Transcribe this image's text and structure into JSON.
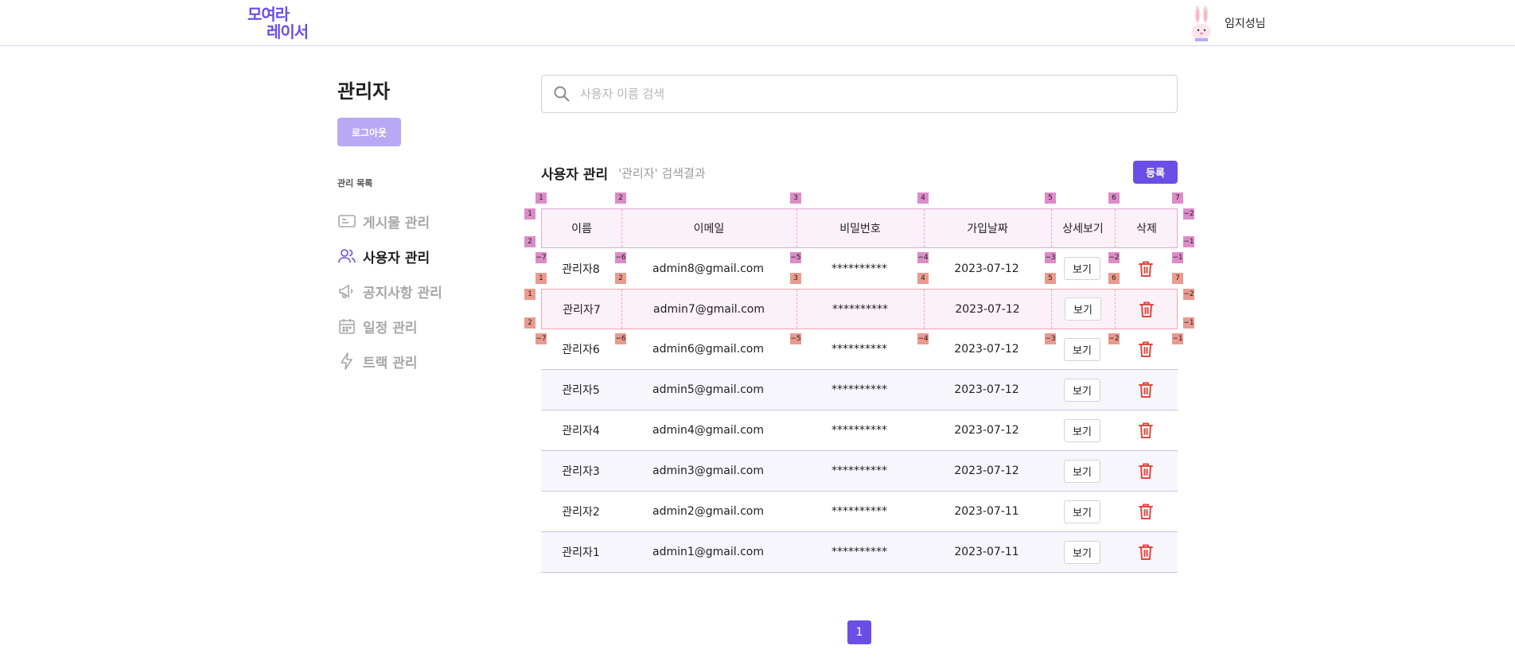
{
  "header": {
    "logo_line1": "모여라",
    "logo_line2": "레이서",
    "user_name": "임지성님"
  },
  "sidebar": {
    "title": "관리자",
    "logout_label": "로그아웃",
    "menu_title": "관리 목록",
    "items": [
      {
        "label": "게시물 관리",
        "icon": "card-icon",
        "active": false
      },
      {
        "label": "사용자 관리",
        "icon": "users-icon",
        "active": true
      },
      {
        "label": "공지사항 관리",
        "icon": "megaphone-icon",
        "active": false
      },
      {
        "label": "일정 관리",
        "icon": "calendar-icon",
        "active": false
      },
      {
        "label": "트랙 관리",
        "icon": "lightning-icon",
        "active": false
      }
    ]
  },
  "search": {
    "placeholder": "사용자 이름 검색"
  },
  "section": {
    "title": "사용자 관리",
    "subtitle": "'관리자' 검색결과",
    "register_label": "등록"
  },
  "table": {
    "headers": [
      "이름",
      "이메일",
      "비밀번호",
      "가입날짜",
      "상세보기",
      "삭제"
    ],
    "view_label": "보기",
    "rows": [
      {
        "name": "관리자8",
        "email": "admin8@gmail.com",
        "password": "**********",
        "date": "2023-07-12"
      },
      {
        "name": "관리자7",
        "email": "admin7@gmail.com",
        "password": "**********",
        "date": "2023-07-12"
      },
      {
        "name": "관리자6",
        "email": "admin6@gmail.com",
        "password": "**********",
        "date": "2023-07-12"
      },
      {
        "name": "관리자5",
        "email": "admin5@gmail.com",
        "password": "**********",
        "date": "2023-07-12"
      },
      {
        "name": "관리자4",
        "email": "admin4@gmail.com",
        "password": "**********",
        "date": "2023-07-12"
      },
      {
        "name": "관리자3",
        "email": "admin3@gmail.com",
        "password": "**********",
        "date": "2023-07-12"
      },
      {
        "name": "관리자2",
        "email": "admin2@gmail.com",
        "password": "**********",
        "date": "2023-07-11"
      },
      {
        "name": "관리자1",
        "email": "admin1@gmail.com",
        "password": "**********",
        "date": "2023-07-11"
      }
    ]
  },
  "pagination": {
    "current": "1"
  },
  "colors": {
    "accent": "#6b4ee6",
    "accent_light": "#b9a8f4",
    "danger": "#e0483e"
  }
}
